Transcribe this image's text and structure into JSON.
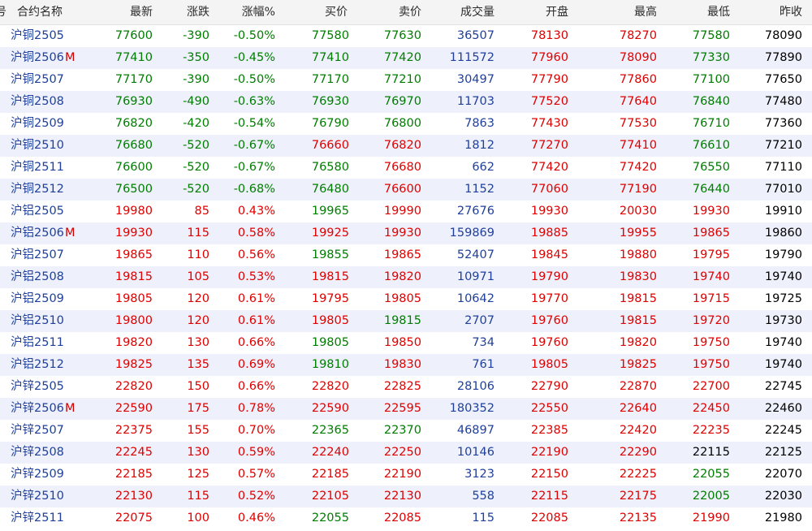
{
  "colors": {
    "up": "#e00000",
    "down": "#007d00",
    "flat": "#000000",
    "volume": "#1f3f9a",
    "name": "#1f3f9a"
  },
  "header": {
    "num": "号",
    "name": "合约名称",
    "last": "最新",
    "change": "涨跌",
    "pct": "涨幅%",
    "bid": "买价",
    "ask": "卖价",
    "volume": "成交量",
    "open": "开盘",
    "high": "最高",
    "low": "最低",
    "prev": "昨收"
  },
  "rows": [
    {
      "name": "沪铜2505",
      "mark": "",
      "last": "77600",
      "change": "-390",
      "pct": "-0.50%",
      "bid": "77580",
      "ask": "77630",
      "volume": "36507",
      "open": "78130",
      "high": "78270",
      "low": "77580",
      "prev": "78090",
      "c": {
        "last": "green",
        "change": "green",
        "pct": "green",
        "bid": "green",
        "ask": "green",
        "open": "red",
        "high": "red",
        "low": "green"
      }
    },
    {
      "name": "沪铜2506",
      "mark": "M",
      "last": "77410",
      "change": "-350",
      "pct": "-0.45%",
      "bid": "77410",
      "ask": "77420",
      "volume": "111572",
      "open": "77960",
      "high": "78090",
      "low": "77330",
      "prev": "77890",
      "c": {
        "last": "green",
        "change": "green",
        "pct": "green",
        "bid": "green",
        "ask": "green",
        "open": "red",
        "high": "red",
        "low": "green"
      }
    },
    {
      "name": "沪铜2507",
      "mark": "",
      "last": "77170",
      "change": "-390",
      "pct": "-0.50%",
      "bid": "77170",
      "ask": "77210",
      "volume": "30497",
      "open": "77790",
      "high": "77860",
      "low": "77100",
      "prev": "77650",
      "c": {
        "last": "green",
        "change": "green",
        "pct": "green",
        "bid": "green",
        "ask": "green",
        "open": "red",
        "high": "red",
        "low": "green"
      }
    },
    {
      "name": "沪铜2508",
      "mark": "",
      "last": "76930",
      "change": "-490",
      "pct": "-0.63%",
      "bid": "76930",
      "ask": "76970",
      "volume": "11703",
      "open": "77520",
      "high": "77640",
      "low": "76840",
      "prev": "77480",
      "c": {
        "last": "green",
        "change": "green",
        "pct": "green",
        "bid": "green",
        "ask": "green",
        "open": "red",
        "high": "red",
        "low": "green"
      }
    },
    {
      "name": "沪铜2509",
      "mark": "",
      "last": "76820",
      "change": "-420",
      "pct": "-0.54%",
      "bid": "76790",
      "ask": "76800",
      "volume": "7863",
      "open": "77430",
      "high": "77530",
      "low": "76710",
      "prev": "77360",
      "c": {
        "last": "green",
        "change": "green",
        "pct": "green",
        "bid": "green",
        "ask": "green",
        "open": "red",
        "high": "red",
        "low": "green"
      }
    },
    {
      "name": "沪铜2510",
      "mark": "",
      "last": "76680",
      "change": "-520",
      "pct": "-0.67%",
      "bid": "76660",
      "ask": "76820",
      "volume": "1812",
      "open": "77270",
      "high": "77410",
      "low": "76610",
      "prev": "77210",
      "c": {
        "last": "green",
        "change": "green",
        "pct": "green",
        "bid": "red",
        "ask": "red",
        "open": "red",
        "high": "red",
        "low": "green"
      }
    },
    {
      "name": "沪铜2511",
      "mark": "",
      "last": "76600",
      "change": "-520",
      "pct": "-0.67%",
      "bid": "76580",
      "ask": "76680",
      "volume": "662",
      "open": "77420",
      "high": "77420",
      "low": "76550",
      "prev": "77110",
      "c": {
        "last": "green",
        "change": "green",
        "pct": "green",
        "bid": "green",
        "ask": "red",
        "open": "red",
        "high": "red",
        "low": "green"
      }
    },
    {
      "name": "沪铜2512",
      "mark": "",
      "last": "76500",
      "change": "-520",
      "pct": "-0.68%",
      "bid": "76480",
      "ask": "76600",
      "volume": "1152",
      "open": "77060",
      "high": "77190",
      "low": "76440",
      "prev": "77010",
      "c": {
        "last": "green",
        "change": "green",
        "pct": "green",
        "bid": "green",
        "ask": "red",
        "open": "red",
        "high": "red",
        "low": "green"
      }
    },
    {
      "name": "沪铝2505",
      "mark": "",
      "last": "19980",
      "change": "85",
      "pct": "0.43%",
      "bid": "19965",
      "ask": "19990",
      "volume": "27676",
      "open": "19930",
      "high": "20030",
      "low": "19930",
      "prev": "19910",
      "c": {
        "last": "red",
        "change": "red",
        "pct": "red",
        "bid": "green",
        "ask": "red",
        "open": "red",
        "high": "red",
        "low": "red"
      }
    },
    {
      "name": "沪铝2506",
      "mark": "M",
      "last": "19930",
      "change": "115",
      "pct": "0.58%",
      "bid": "19925",
      "ask": "19930",
      "volume": "159869",
      "open": "19885",
      "high": "19955",
      "low": "19865",
      "prev": "19860",
      "c": {
        "last": "red",
        "change": "red",
        "pct": "red",
        "bid": "red",
        "ask": "red",
        "open": "red",
        "high": "red",
        "low": "red"
      }
    },
    {
      "name": "沪铝2507",
      "mark": "",
      "last": "19865",
      "change": "110",
      "pct": "0.56%",
      "bid": "19855",
      "ask": "19865",
      "volume": "52407",
      "open": "19845",
      "high": "19880",
      "low": "19795",
      "prev": "19790",
      "c": {
        "last": "red",
        "change": "red",
        "pct": "red",
        "bid": "green",
        "ask": "red",
        "open": "red",
        "high": "red",
        "low": "red"
      }
    },
    {
      "name": "沪铝2508",
      "mark": "",
      "last": "19815",
      "change": "105",
      "pct": "0.53%",
      "bid": "19815",
      "ask": "19820",
      "volume": "10971",
      "open": "19790",
      "high": "19830",
      "low": "19740",
      "prev": "19740",
      "c": {
        "last": "red",
        "change": "red",
        "pct": "red",
        "bid": "red",
        "ask": "red",
        "open": "red",
        "high": "red",
        "low": "red"
      }
    },
    {
      "name": "沪铝2509",
      "mark": "",
      "last": "19805",
      "change": "120",
      "pct": "0.61%",
      "bid": "19795",
      "ask": "19805",
      "volume": "10642",
      "open": "19770",
      "high": "19815",
      "low": "19715",
      "prev": "19725",
      "c": {
        "last": "red",
        "change": "red",
        "pct": "red",
        "bid": "red",
        "ask": "red",
        "open": "red",
        "high": "red",
        "low": "red"
      }
    },
    {
      "name": "沪铝2510",
      "mark": "",
      "last": "19800",
      "change": "120",
      "pct": "0.61%",
      "bid": "19805",
      "ask": "19815",
      "volume": "2707",
      "open": "19760",
      "high": "19815",
      "low": "19720",
      "prev": "19730",
      "c": {
        "last": "red",
        "change": "red",
        "pct": "red",
        "bid": "red",
        "ask": "green",
        "open": "red",
        "high": "red",
        "low": "red"
      }
    },
    {
      "name": "沪铝2511",
      "mark": "",
      "last": "19820",
      "change": "130",
      "pct": "0.66%",
      "bid": "19805",
      "ask": "19850",
      "volume": "734",
      "open": "19760",
      "high": "19820",
      "low": "19750",
      "prev": "19740",
      "c": {
        "last": "red",
        "change": "red",
        "pct": "red",
        "bid": "green",
        "ask": "red",
        "open": "red",
        "high": "red",
        "low": "red"
      }
    },
    {
      "name": "沪铝2512",
      "mark": "",
      "last": "19825",
      "change": "135",
      "pct": "0.69%",
      "bid": "19810",
      "ask": "19830",
      "volume": "761",
      "open": "19805",
      "high": "19825",
      "low": "19750",
      "prev": "19740",
      "c": {
        "last": "red",
        "change": "red",
        "pct": "red",
        "bid": "green",
        "ask": "red",
        "open": "red",
        "high": "red",
        "low": "red"
      }
    },
    {
      "name": "沪锌2505",
      "mark": "",
      "last": "22820",
      "change": "150",
      "pct": "0.66%",
      "bid": "22820",
      "ask": "22825",
      "volume": "28106",
      "open": "22790",
      "high": "22870",
      "low": "22700",
      "prev": "22745",
      "c": {
        "last": "red",
        "change": "red",
        "pct": "red",
        "bid": "red",
        "ask": "red",
        "open": "red",
        "high": "red",
        "low": "red"
      }
    },
    {
      "name": "沪锌2506",
      "mark": "M",
      "last": "22590",
      "change": "175",
      "pct": "0.78%",
      "bid": "22590",
      "ask": "22595",
      "volume": "180352",
      "open": "22550",
      "high": "22640",
      "low": "22450",
      "prev": "22460",
      "c": {
        "last": "red",
        "change": "red",
        "pct": "red",
        "bid": "red",
        "ask": "red",
        "open": "red",
        "high": "red",
        "low": "red"
      }
    },
    {
      "name": "沪锌2507",
      "mark": "",
      "last": "22375",
      "change": "155",
      "pct": "0.70%",
      "bid": "22365",
      "ask": "22370",
      "volume": "46897",
      "open": "22385",
      "high": "22420",
      "low": "22235",
      "prev": "22245",
      "c": {
        "last": "red",
        "change": "red",
        "pct": "red",
        "bid": "green",
        "ask": "green",
        "open": "red",
        "high": "red",
        "low": "red"
      }
    },
    {
      "name": "沪锌2508",
      "mark": "",
      "last": "22245",
      "change": "130",
      "pct": "0.59%",
      "bid": "22240",
      "ask": "22250",
      "volume": "10146",
      "open": "22190",
      "high": "22290",
      "low": "22115",
      "prev": "22125",
      "c": {
        "last": "red",
        "change": "red",
        "pct": "red",
        "bid": "red",
        "ask": "red",
        "open": "red",
        "high": "red",
        "low": "black"
      }
    },
    {
      "name": "沪锌2509",
      "mark": "",
      "last": "22185",
      "change": "125",
      "pct": "0.57%",
      "bid": "22185",
      "ask": "22190",
      "volume": "3123",
      "open": "22150",
      "high": "22225",
      "low": "22055",
      "prev": "22070",
      "c": {
        "last": "red",
        "change": "red",
        "pct": "red",
        "bid": "red",
        "ask": "red",
        "open": "red",
        "high": "red",
        "low": "green"
      }
    },
    {
      "name": "沪锌2510",
      "mark": "",
      "last": "22130",
      "change": "115",
      "pct": "0.52%",
      "bid": "22105",
      "ask": "22130",
      "volume": "558",
      "open": "22115",
      "high": "22175",
      "low": "22005",
      "prev": "22030",
      "c": {
        "last": "red",
        "change": "red",
        "pct": "red",
        "bid": "red",
        "ask": "red",
        "open": "red",
        "high": "red",
        "low": "green"
      }
    },
    {
      "name": "沪锌2511",
      "mark": "",
      "last": "22075",
      "change": "100",
      "pct": "0.46%",
      "bid": "22055",
      "ask": "22085",
      "volume": "115",
      "open": "22085",
      "high": "22135",
      "low": "21990",
      "prev": "21980",
      "c": {
        "last": "red",
        "change": "red",
        "pct": "red",
        "bid": "green",
        "ask": "red",
        "open": "red",
        "high": "red",
        "low": "red"
      }
    }
  ]
}
